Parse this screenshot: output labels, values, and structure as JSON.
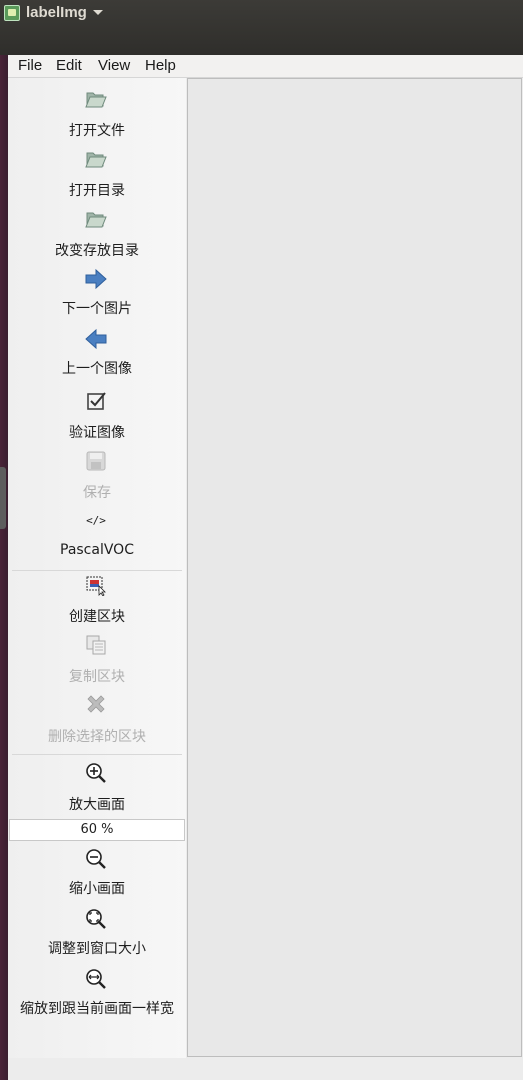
{
  "window": {
    "app_name": "labelImg"
  },
  "menu": [
    "File",
    "Edit",
    "View",
    "Help"
  ],
  "toolbar": {
    "open_file": "打开文件",
    "open_dir": "打开目录",
    "change_save_dir": "改变存放目录",
    "next_image": "下一个图片",
    "prev_image": "上一个图像",
    "verify_image": "验证图像",
    "save": "保存",
    "format": "PascalVOC",
    "create_box": "创建区块",
    "duplicate_box": "复制区块",
    "delete_box": "删除选择的区块",
    "zoom_in": "放大画面",
    "zoom_value": "60 %",
    "zoom_out": "缩小画面",
    "fit_window": "调整到窗口大小",
    "fit_width": "缩放到跟当前画面一样宽",
    "format_icon_text": "</>"
  },
  "icons": {
    "open_file": "folder-open-icon",
    "open_dir": "folder-open-icon",
    "change_save_dir": "folder-open-icon",
    "next_image": "arrow-right-icon",
    "prev_image": "arrow-left-icon",
    "verify_image": "checkbox-icon",
    "save": "floppy-disk-icon",
    "format": "code-icon",
    "create_box": "create-box-icon",
    "duplicate_box": "copy-icon",
    "delete_box": "delete-x-icon",
    "zoom_in": "zoom-in-icon",
    "zoom_out": "zoom-out-icon",
    "fit_window": "fit-window-icon",
    "fit_width": "fit-width-icon"
  },
  "colors": {
    "accent_blue": "#4a7fc1",
    "disabled_text": "#b0b0b0"
  }
}
